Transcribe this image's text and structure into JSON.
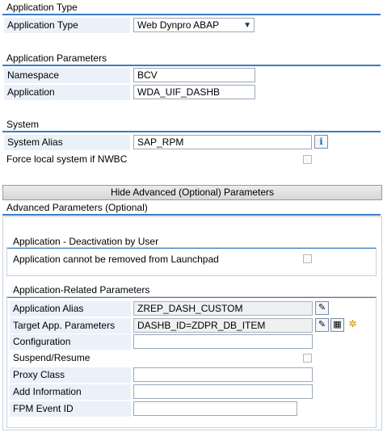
{
  "application_type": {
    "section_title": "Application Type",
    "label": "Application Type",
    "value": "Web Dynpro ABAP"
  },
  "application_parameters": {
    "section_title": "Application Parameters",
    "namespace_label": "Namespace",
    "namespace_value": "BCV",
    "application_label": "Application",
    "application_value": "WDA_UIF_DASHB"
  },
  "system": {
    "section_title": "System",
    "alias_label": "System Alias",
    "alias_value": "SAP_RPM",
    "force_local_label": "Force local system if NWBC"
  },
  "toggle_button_label": "Hide Advanced (Optional) Parameters",
  "advanced": {
    "section_title": "Advanced Parameters (Optional)",
    "deactivation": {
      "title": "Application - Deactivation by User",
      "cannot_remove_label": "Application cannot be removed from Launchpad"
    },
    "related": {
      "title": "Application-Related Parameters",
      "alias_label": "Application Alias",
      "alias_value": "ZREP_DASH_CUSTOM",
      "target_label": "Target App. Parameters",
      "target_value": "DASHB_ID=ZDPR_DB_ITEM",
      "configuration_label": "Configuration",
      "suspend_label": "Suspend/Resume",
      "proxy_label": "Proxy Class",
      "add_info_label": "Add Information",
      "fpm_label": "FPM Event ID"
    }
  }
}
